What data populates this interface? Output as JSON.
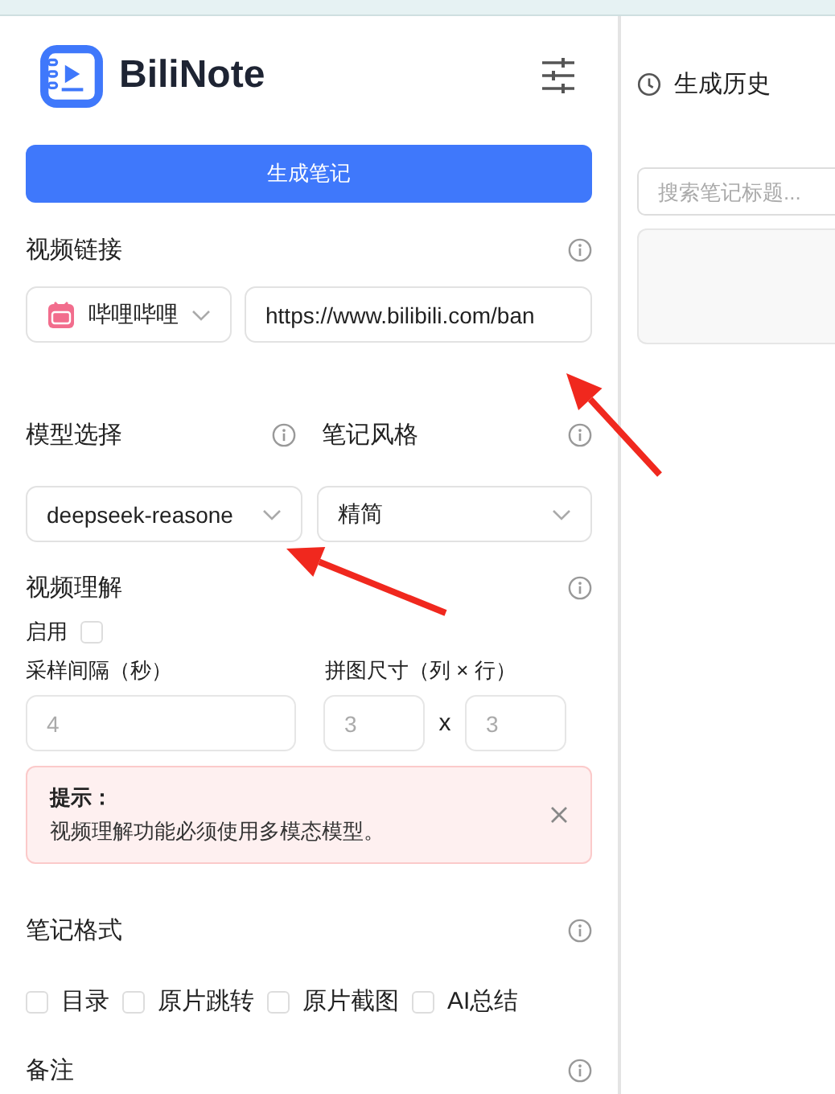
{
  "logo": {
    "title": "BiliNote"
  },
  "generate_button": "生成笔记",
  "video_link": {
    "label": "视频链接",
    "platform": "哔哩哔哩",
    "url": "https://www.bilibili.com/ban"
  },
  "model": {
    "label": "模型选择",
    "value": "deepseek-reasone"
  },
  "style": {
    "label": "笔记风格",
    "value": "精简"
  },
  "video_understanding": {
    "label": "视频理解",
    "enable_label": "启用",
    "enabled": false,
    "interval_label": "采样间隔（秒）",
    "interval_placeholder": "4",
    "grid_label": "拼图尺寸（列 × 行）",
    "grid_cols_placeholder": "3",
    "times": "x",
    "grid_rows_placeholder": "3"
  },
  "alert": {
    "title": "提示：",
    "message": "视频理解功能必须使用多模态模型。"
  },
  "note_format": {
    "label": "笔记格式",
    "options": [
      {
        "label": "目录",
        "checked": false
      },
      {
        "label": "原片跳转",
        "checked": false
      },
      {
        "label": "原片截图",
        "checked": false
      },
      {
        "label": "AI总结",
        "checked": false
      }
    ]
  },
  "remark": {
    "label": "备注"
  },
  "history": {
    "title": "生成历史",
    "search_placeholder": "搜索笔记标题..."
  },
  "annotations": [
    {
      "kind": "arrow"
    },
    {
      "kind": "arrow"
    }
  ]
}
